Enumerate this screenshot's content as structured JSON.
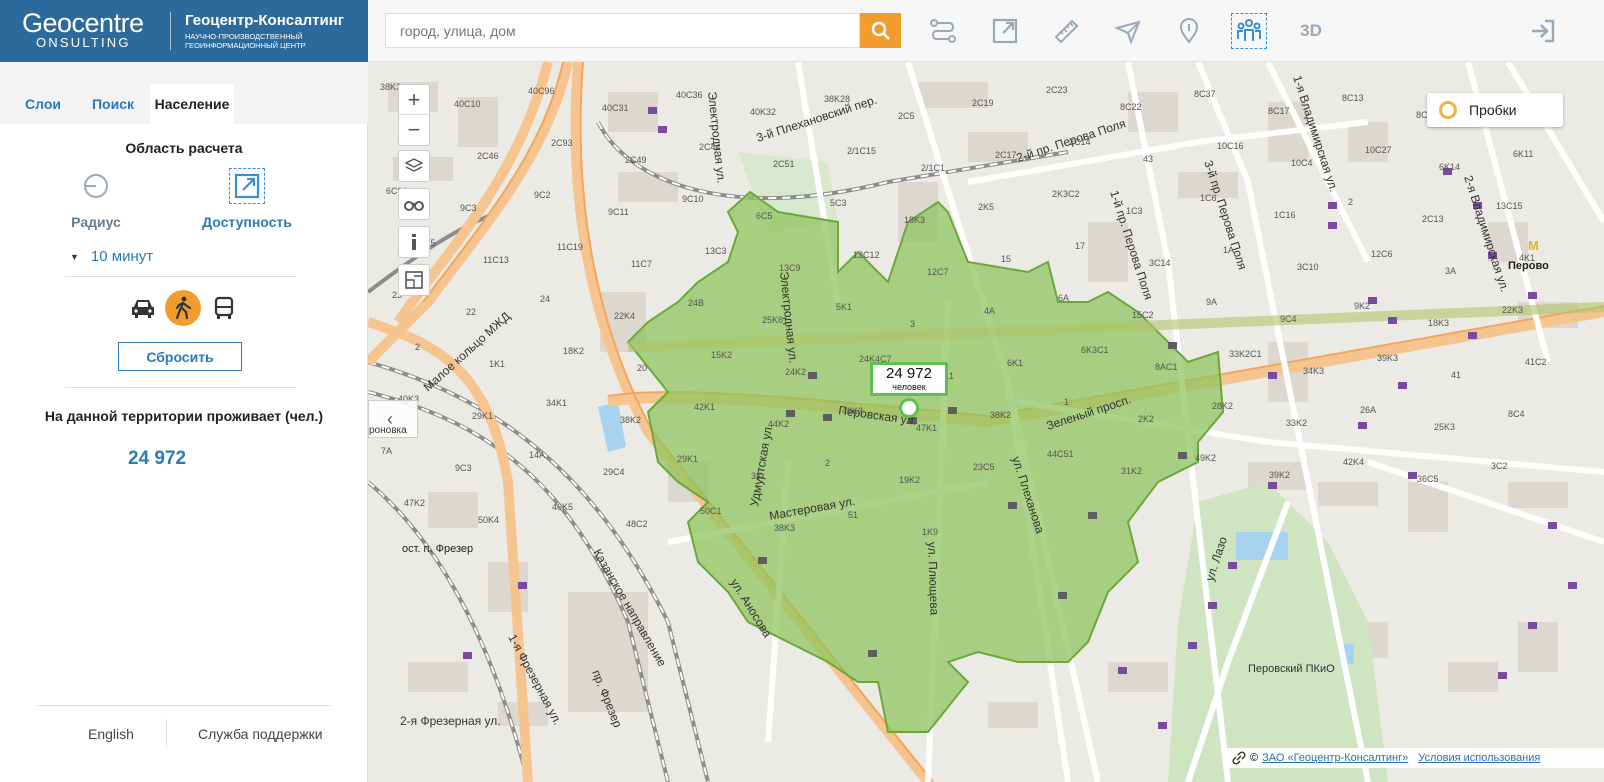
{
  "header": {
    "logo_line1": "Geocentre",
    "logo_line2": "ONSULTING",
    "company_name": "Геоцентр-Консалтинг",
    "company_sub": "Научно-производственный геоинформационный центр",
    "search_placeholder": "город, улица, дом",
    "tools": [
      "route-icon",
      "share-icon",
      "ruler-icon",
      "send-icon",
      "pin-icon",
      "population-icon",
      "3d-toggle"
    ],
    "tool_3d_label": "3D"
  },
  "sidebar": {
    "tabs": [
      {
        "label": "Слои",
        "active": false
      },
      {
        "label": "Поиск",
        "active": false
      },
      {
        "label": "Население",
        "active": true
      }
    ],
    "area_title": "Область расчета",
    "mode_radius": "Радиус",
    "mode_access": "Доступность",
    "time_value": "10 минут",
    "transport_modes": [
      "car-icon",
      "walk-icon",
      "bus-icon"
    ],
    "active_transport": "walk",
    "reset_label": "Сбросить",
    "population_label": "На данной территории проживает (чел.)",
    "population_value": "24 972",
    "footer_lang": "English",
    "footer_support": "Служба поддержки"
  },
  "map": {
    "traffic_label": "Пробки",
    "collapse_label": "роновка",
    "marker_value": "24 972",
    "marker_unit": "человек",
    "attribution_copy": "©",
    "attribution_link": "ЗАО «Геоцентр-Консалтинг»",
    "terms_link": "Условия использования",
    "accent_green": "#8cc35a",
    "accent_orange": "#f39c2e",
    "accent_blue": "#2b7ab8",
    "street_labels": [
      "Перовская ул.",
      "Электродная ул.",
      "Зеленый просп.",
      "ул. Плеханова",
      "ул. Плющева",
      "Мастеровая ул.",
      "Удмуртская ул.",
      "ул. Аносова",
      "3-й Плехановский пер.",
      "2-й пр. Перова Поля",
      "1-й пр. Перова Поля",
      "3-й пр. Перова Поля",
      "1-я Владимирская ул.",
      "2-я Владимирская ул.",
      "Малое кольцо МЖД",
      "Казанское направление",
      "1-я Фрезерная ул.",
      "2-я Фрезерная ул.",
      "пр. Фрезер",
      "ул. Лазо",
      "Электродная ул."
    ],
    "place_labels": [
      "Перово",
      "ост. п. Фрезер",
      "Перовский ПКиО"
    ],
    "building_labels": [
      "38K3",
      "40C10",
      "40C96",
      "40C31",
      "40C36",
      "40K32",
      "38K28",
      "2C5",
      "2C19",
      "2C23",
      "8C22",
      "8C37",
      "8C17",
      "8C13",
      "8C10",
      "1AC12",
      "1AC5",
      "2C46",
      "2C93",
      "2C49",
      "2C44",
      "2C51",
      "2/1C15",
      "2/1C1",
      "2C17",
      "2C14",
      "43",
      "10C16",
      "10C4",
      "10C27",
      "6K14",
      "6K11",
      "6C9A",
      "9C3",
      "9C2",
      "9C11",
      "9C10",
      "6C5",
      "5C3",
      "18K3",
      "2K5",
      "2K3C2",
      "1C3",
      "1C6",
      "1C16",
      "2",
      "2C13",
      "13C15",
      "10C15",
      "11C13",
      "11C19",
      "11C7",
      "13C3",
      "13C9",
      "13C12",
      "12C7",
      "15",
      "17",
      "3C14",
      "1A",
      "3C10",
      "12C6",
      "3A",
      "4K1",
      "23",
      "22",
      "24",
      "22K4",
      "24B",
      "25K6",
      "5K1",
      "3",
      "4A",
      "6A",
      "15C2",
      "9A",
      "9C4",
      "9K2",
      "18K3",
      "22K3",
      "2",
      "1K1",
      "18K2",
      "20",
      "15K2",
      "24K2",
      "24K4C7",
      "26K1",
      "6K1",
      "6K3C1",
      "8AC1",
      "33K2C1",
      "34K3",
      "39K3",
      "41",
      "41C2",
      "40K3",
      "29K1",
      "34K1",
      "38K2",
      "42K1",
      "44K2",
      "46K3",
      "47K1",
      "38K2",
      "1",
      "2K2",
      "28K2",
      "33K2",
      "26A",
      "25K3",
      "8C4",
      "7A",
      "9C3",
      "14A",
      "29C4",
      "29K1",
      "33",
      "2",
      "19K2",
      "23C5",
      "44C51",
      "31K2",
      "49K2",
      "39K2",
      "42K4",
      "36C5",
      "3C2",
      "47K2",
      "50K4",
      "46K5",
      "48C2",
      "50C1",
      "38K3",
      "51",
      "1K9"
    ]
  }
}
